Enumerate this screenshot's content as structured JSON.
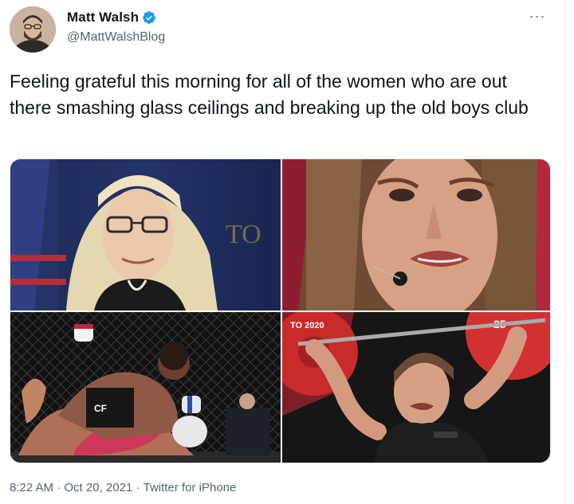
{
  "author": {
    "display_name": "Matt Walsh",
    "handle": "@MattWalshBlog",
    "verified": true,
    "avatar_icon": "profile-photo"
  },
  "more_icon": "ellipsis-icon",
  "more_glyph": "···",
  "tweet": {
    "text": "Feeling grateful this morning for all of the women who are out there smashing glass ceilings and breaking up the old boys club"
  },
  "media": {
    "count": 4,
    "photos": [
      "photo-1",
      "photo-2",
      "photo-3",
      "photo-4"
    ]
  },
  "meta": {
    "time": "8:22 AM",
    "separator": " · ",
    "date": "Oct 20, 2021",
    "source": "Twitter for iPhone"
  },
  "colors": {
    "text": "#0f1419",
    "secondary": "#536471",
    "verified": "#1d9bf0"
  }
}
